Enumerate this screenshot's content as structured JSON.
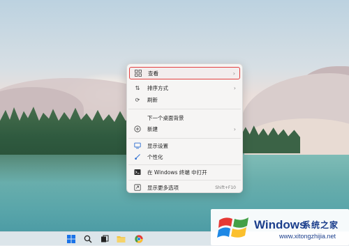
{
  "context_menu": {
    "items": [
      {
        "label": "查看",
        "icon": "view-grid-icon",
        "submenu": true
      },
      {
        "label": "排序方式",
        "icon": "sort-icon",
        "submenu": true
      },
      {
        "label": "刷新",
        "icon": "refresh-icon",
        "submenu": false
      },
      {
        "label": "下一个桌面背景",
        "icon": "",
        "submenu": false
      },
      {
        "label": "新建",
        "icon": "new-plus-icon",
        "submenu": true
      },
      {
        "label": "显示设置",
        "icon": "display-icon",
        "submenu": false
      },
      {
        "label": "个性化",
        "icon": "brush-icon",
        "submenu": false
      },
      {
        "label": "在 Windows 终端 中打开",
        "icon": "terminal-icon",
        "submenu": false
      },
      {
        "label": "显示更多选项",
        "icon": "more-options-icon",
        "submenu": false,
        "shortcut": "Shift+F10"
      }
    ],
    "highlight_color": "#e34040"
  },
  "taskbar": {
    "icons": [
      "windows-start-icon",
      "search-icon",
      "task-view-icon",
      "file-explorer-icon",
      "chrome-icon"
    ]
  },
  "watermark": {
    "brand": "Windows",
    "cn_text": "系统之家",
    "url": "www.xitongzhijia.net",
    "color": "#1b3e8c"
  }
}
